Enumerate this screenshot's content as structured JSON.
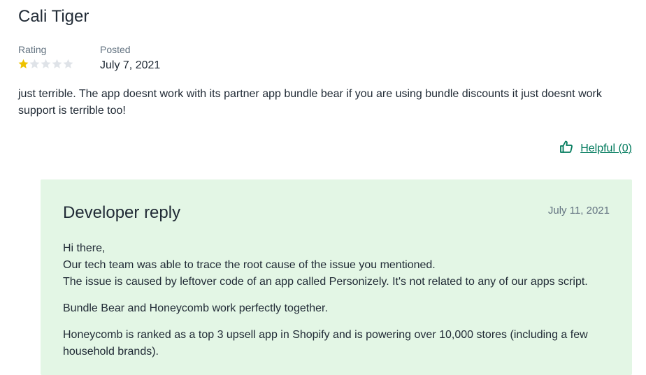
{
  "review": {
    "reviewer_name": "Cali Tiger",
    "rating_label": "Rating",
    "rating_value": 1,
    "rating_max": 5,
    "posted_label": "Posted",
    "posted_date": "July 7, 2021",
    "body": "just terrible. The app doesnt work with its partner app bundle bear if you are using bundle discounts it just doesnt work support is terrible too!",
    "helpful_label": "Helpful (0)"
  },
  "reply": {
    "title": "Developer reply",
    "date": "July 11, 2021",
    "para1_line1": "Hi there,",
    "para1_line2": "Our tech team was able to trace the root cause of the issue you mentioned.",
    "para1_line3": "The issue is caused by leftover code of an app called Personizely. It's not related to any of our apps script.",
    "para2": "Bundle Bear and Honeycomb work perfectly together.",
    "para3": "Honeycomb is ranked as a top 3 upsell app in Shopify and is powering over 10,000 stores (including a few household brands)."
  },
  "colors": {
    "star_filled": "#eec200",
    "star_empty": "#dfe3e8",
    "link_green": "#007a5c",
    "reply_bg": "#e3f6e5"
  },
  "icons": {
    "helpful": "thumbs-up-icon",
    "rating": "star-icon"
  }
}
